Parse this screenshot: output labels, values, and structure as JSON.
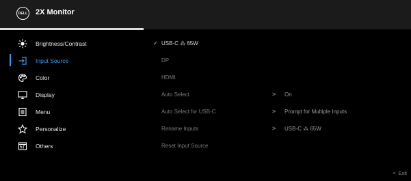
{
  "header": {
    "logo_text": "DELL",
    "title": "2X Monitor"
  },
  "menu": [
    {
      "label": "Brightness/Contrast",
      "icon": "brightness-icon"
    },
    {
      "label": "Input Source",
      "icon": "input-source-icon",
      "active": true
    },
    {
      "label": "Color",
      "icon": "color-palette-icon"
    },
    {
      "label": "Display",
      "icon": "display-icon"
    },
    {
      "label": "Menu",
      "icon": "menu-icon"
    },
    {
      "label": "Personalize",
      "icon": "star-icon"
    },
    {
      "label": "Others",
      "icon": "others-icon"
    }
  ],
  "submenu": {
    "check_mark": "✓",
    "items": [
      {
        "label": "USB-C ⁂ 65W",
        "selected": true
      },
      {
        "label": "DP"
      },
      {
        "label": "HDMI"
      },
      {
        "label": "Auto Select",
        "chevron": ">",
        "value": "On"
      },
      {
        "label": "Auto Select for USB-C",
        "chevron": ">",
        "value": "Prompt for Multiple Inputs"
      },
      {
        "label": "Rename Inputs",
        "chevron": ">",
        "value": "USB-C ⁂ 65W"
      },
      {
        "label": "Reset Input Source"
      }
    ]
  },
  "footer": {
    "exit_arrow": "<",
    "exit_label": "Exit"
  },
  "colors": {
    "accent": "#3d9be9",
    "header_bg": "#1b1b1b",
    "bg": "#000000"
  }
}
